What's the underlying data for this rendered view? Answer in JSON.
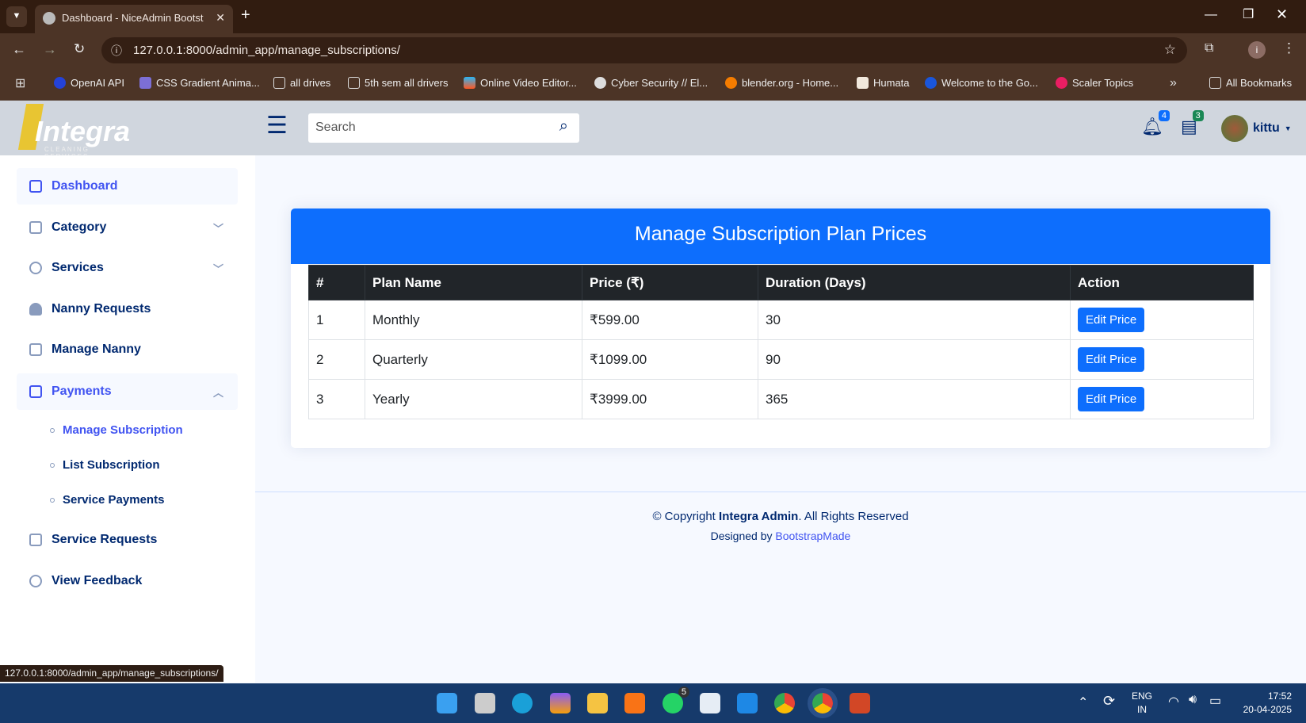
{
  "browser": {
    "tab_title": "Dashboard - NiceAdmin Bootst",
    "url": "127.0.0.1:8000/admin_app/manage_subscriptions/",
    "profile": "i",
    "bookmarks": [
      "OpenAI API",
      "CSS Gradient Anima...",
      "all drives",
      "5th sem all drivers",
      "Online Video Editor...",
      "Cyber Security // El...",
      "blender.org - Home...",
      "Humata",
      "Welcome to the Go...",
      "Scaler Topics"
    ],
    "all_bookmarks": "All Bookmarks",
    "status_url": "127.0.0.1:8000/admin_app/manage_subscriptions/"
  },
  "header": {
    "logo": "Integra",
    "logo_sub": "CLEANING SERVICES",
    "search_placeholder": "Search",
    "notifications": "4",
    "messages": "3",
    "user": "kittu"
  },
  "sidebar": {
    "items": [
      "Dashboard",
      "Category",
      "Services",
      "Nanny Requests",
      "Manage Nanny",
      "Payments",
      "Service Requests",
      "View Feedback"
    ],
    "payments_sub": [
      "Manage Subscription",
      "List Subscription",
      "Service Payments"
    ]
  },
  "main": {
    "title": "Manage Subscription Plan Prices",
    "columns": [
      "#",
      "Plan Name",
      "Price (₹)",
      "Duration (Days)",
      "Action"
    ],
    "rows": [
      {
        "n": "1",
        "name": "Monthly",
        "price": "₹599.00",
        "days": "30"
      },
      {
        "n": "2",
        "name": "Quarterly",
        "price": "₹1099.00",
        "days": "90"
      },
      {
        "n": "3",
        "name": "Yearly",
        "price": "₹3999.00",
        "days": "365"
      }
    ],
    "action_label": "Edit Price"
  },
  "footer": {
    "copy_pre": "© Copyright ",
    "brand": "Integra Admin",
    "copy_post": ". All Rights Reserved",
    "designed": "Designed by ",
    "link": "BootstrapMade"
  },
  "taskbar": {
    "lang": "ENG",
    "region": "IN",
    "time": "17:52",
    "date": "20-04-2025",
    "whatsapp_badge": "5"
  }
}
